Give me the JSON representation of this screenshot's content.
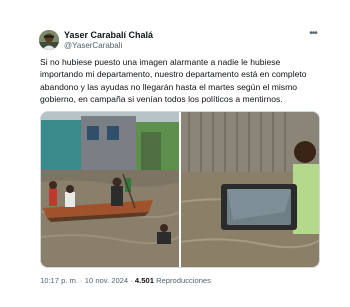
{
  "tweet": {
    "author_name": "Yaser Carabalí Chalá",
    "author_handle": "@YaserCarabali",
    "text": "Si no hubiese puesto una imagen alarmante a nadie le hubiese importando mi departamento, nuestro departamento está en completo abandono y las ayudas no llegarán hasta el martes según el mismo gobierno, en campaña si venían todos los políticos a mentirnos.",
    "time": "10:17 p. m.",
    "separator": "·",
    "date": "10 nov. 2024",
    "views_count": "4.501",
    "views_label": "Reproducciones"
  },
  "icons": {
    "more": "more-horizontal-icon"
  },
  "colors": {
    "text": "#0f1419",
    "secondary": "#536471",
    "border": "#cfd9de"
  }
}
